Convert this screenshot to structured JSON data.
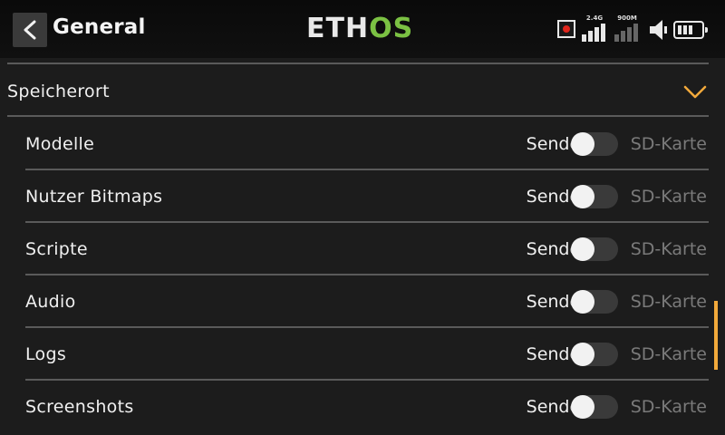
{
  "header": {
    "back_icon": "chevron-left-icon",
    "title": "General",
    "logo_part1": "ETH",
    "logo_part2": "OS",
    "status": {
      "record_icon": "record-icon",
      "rf1_label": "2.4G",
      "rf2_label": "900M",
      "speaker_icon": "speaker-icon",
      "battery_icon": "battery-icon"
    }
  },
  "section": {
    "title": "Speicherort",
    "expanded_icon": "chevron-down-icon",
    "accent_color": "#f2a93b"
  },
  "rows": [
    {
      "label": "Modelle",
      "left_option": "Sender",
      "right_option": "SD-Karte",
      "value": "Sender"
    },
    {
      "label": "Nutzer Bitmaps",
      "left_option": "Sender",
      "right_option": "SD-Karte",
      "value": "Sender"
    },
    {
      "label": "Scripte",
      "left_option": "Sender",
      "right_option": "SD-Karte",
      "value": "Sender"
    },
    {
      "label": "Audio",
      "left_option": "Sender",
      "right_option": "SD-Karte",
      "value": "Sender"
    },
    {
      "label": "Logs",
      "left_option": "Sender",
      "right_option": "SD-Karte",
      "value": "Sender"
    },
    {
      "label": "Screenshots",
      "left_option": "Sender",
      "right_option": "SD-Karte",
      "value": "Sender"
    }
  ]
}
